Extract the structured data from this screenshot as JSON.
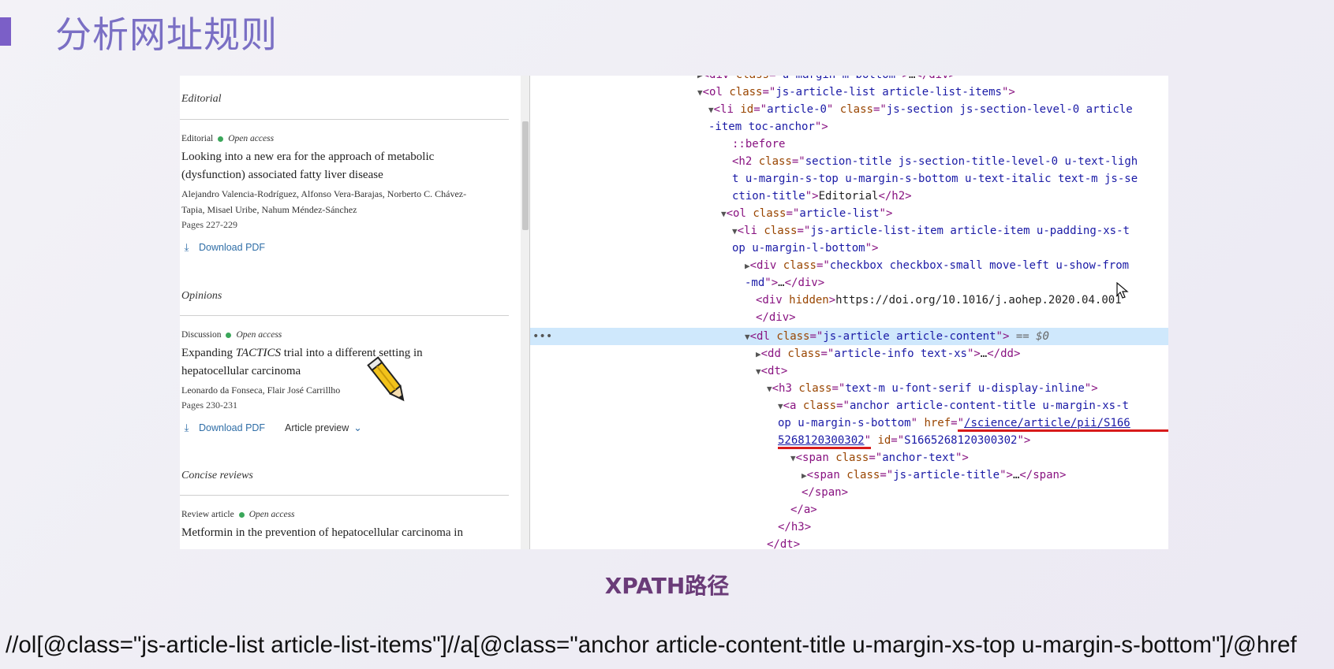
{
  "slide": {
    "title": "分析网址规则",
    "subtitle": "XPATH路径",
    "xpath": "//ol[@class=\"js-article-list article-list-items\"]//a[@class=\"anchor article-content-title u-margin-xs-top u-margin-s-bottom\"]/@href"
  },
  "journal": {
    "sections": [
      {
        "heading": "Editorial",
        "article": {
          "type": "Editorial",
          "access": "Open access",
          "title_line1": "Looking into a new era for the approach of metabolic",
          "title_line2": "(dysfunction) associated fatty liver disease",
          "authors_line1": "Alejandro Valencia-Rodríguez, Alfonso Vera-Barajas, Norberto C. Chávez-",
          "authors_line2": "Tapia, Misael Uribe, Nahum Méndez-Sánchez",
          "pages": "Pages 227-229",
          "download": "Download PDF"
        }
      },
      {
        "heading": "Opinions",
        "article": {
          "type": "Discussion",
          "access": "Open access",
          "title_line1_a": "Expanding ",
          "title_line1_em": "TACTICS",
          "title_line1_b": " trial into a different setting in",
          "title_line2": "hepatocellular carcinoma",
          "authors_line1": "Leonardo da Fonseca, Flair José Carrillho",
          "pages": "Pages 230-231",
          "download": "Download PDF",
          "preview": "Article preview"
        }
      },
      {
        "heading": "Concise reviews",
        "article": {
          "type": "Review article",
          "access": "Open access",
          "title_line1": "Metformin in the prevention of hepatocellular carcinoma in"
        }
      }
    ]
  },
  "devtools": {
    "selected_suffix": "== $0",
    "href_value": "/science/article/pii/S1665268120300302",
    "doi": "https://doi.org/10.1016/j.aohep.2020.04.001"
  },
  "colors": {
    "accent": "#7b5fc7",
    "title": "#7a6fc4",
    "subtitle": "#6a3b78",
    "open_access_dot": "#3ba75a",
    "selection": "#cfe8fc",
    "underline": "#d81b1b"
  }
}
